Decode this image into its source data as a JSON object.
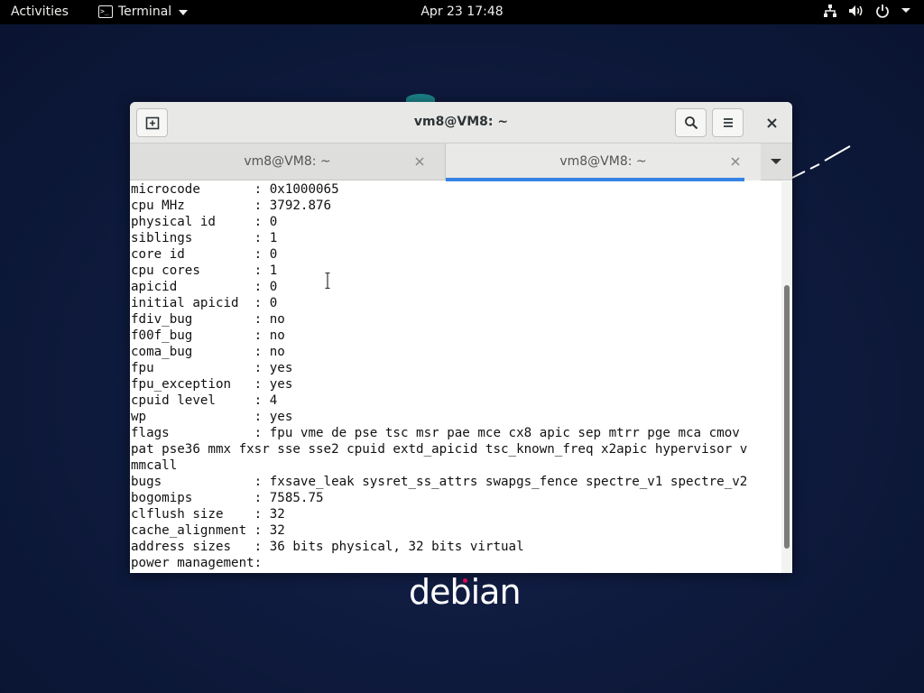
{
  "topbar": {
    "activities": "Activities",
    "app_name": "Terminal",
    "clock": "Apr 23  17:48",
    "icons": [
      "network-icon",
      "volume-icon",
      "power-icon",
      "chevron-down-icon"
    ]
  },
  "window": {
    "title": "vm8@VM8: ~",
    "tabs": [
      {
        "label": "vm8@VM8: ~",
        "active": false
      },
      {
        "label": "vm8@VM8: ~",
        "active": true
      }
    ],
    "terminal_lines": [
      "microcode       : 0x1000065",
      "cpu MHz         : 3792.876",
      "physical id     : 0",
      "siblings        : 1",
      "core id         : 0",
      "cpu cores       : 1",
      "apicid          : 0",
      "initial apicid  : 0",
      "fdiv_bug        : no",
      "f00f_bug        : no",
      "coma_bug        : no",
      "fpu             : yes",
      "fpu_exception   : yes",
      "cpuid level     : 4",
      "wp              : yes",
      "flags           : fpu vme de pse tsc msr pae mce cx8 apic sep mtrr pge mca cmov",
      "pat pse36 mmx fxsr sse sse2 cpuid extd_apicid tsc_known_freq x2apic hypervisor v",
      "mmcall",
      "bugs            : fxsave_leak sysret_ss_attrs swapgs_fence spectre_v1 spectre_v2",
      "bogomips        : 7585.75",
      "clflush size    : 32",
      "cache_alignment : 32",
      "address sizes   : 36 bits physical, 32 bits virtual",
      "power management:"
    ]
  },
  "desktop": {
    "logo_text": "debian"
  },
  "colors": {
    "accent": "#3584e4",
    "desktop": "#0f1b3f",
    "topbar": "#000000",
    "debian_red": "#d70a53"
  }
}
